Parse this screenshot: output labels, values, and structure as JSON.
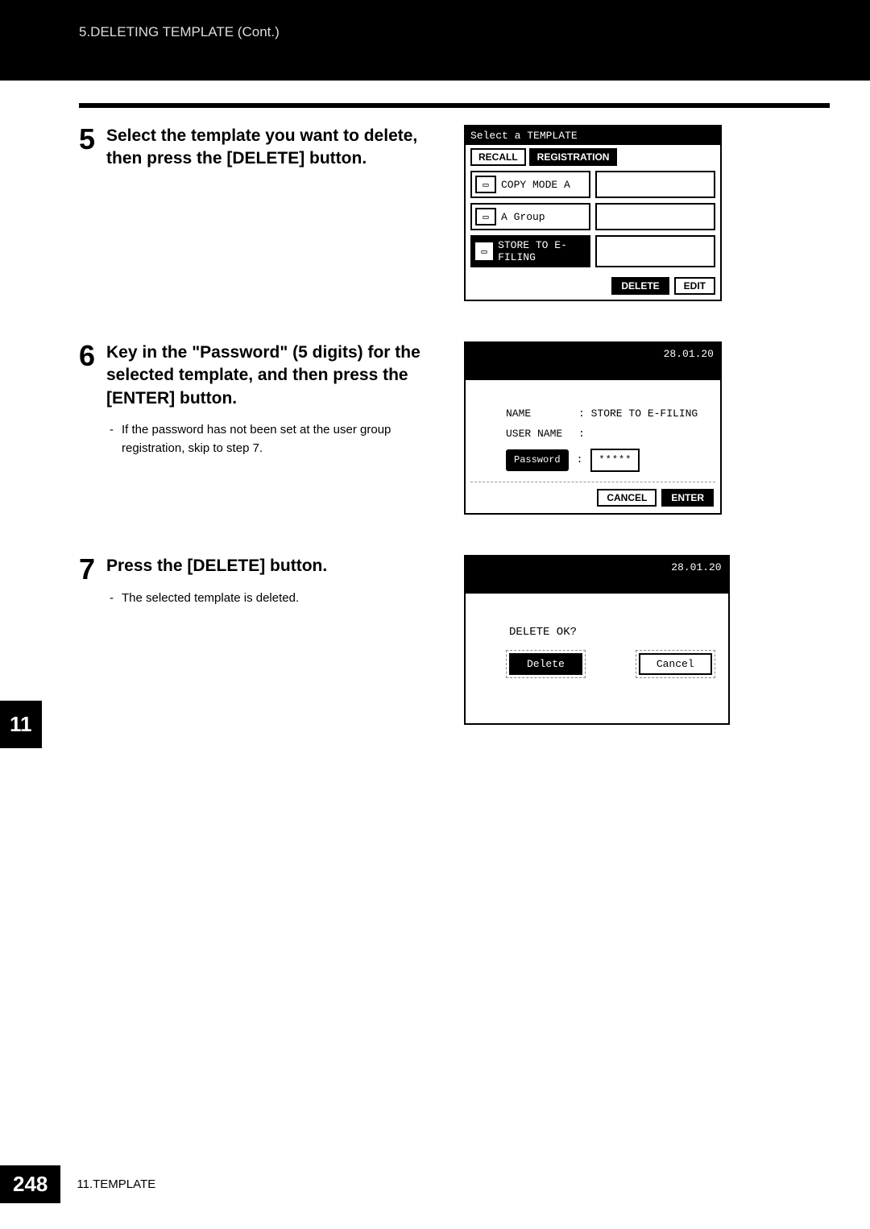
{
  "header": {
    "breadcrumb": "5.DELETING TEMPLATE (Cont.)"
  },
  "sideTab": "11",
  "footer": {
    "pageNum": "248",
    "chapter": "11.TEMPLATE"
  },
  "steps": [
    {
      "num": "5",
      "heading": "Select the template you want to delete, then press the [DELETE] button."
    },
    {
      "num": "6",
      "heading": "Key in the \"Password\" (5 digits) for the selected template, and then press the [ENTER] button.",
      "bullet": "If the password has not been set at the user group registration, skip to step 7."
    },
    {
      "num": "7",
      "heading": "Press the [DELETE] button.",
      "bullet": "The selected template is deleted."
    }
  ],
  "screen1": {
    "title": "Select a TEMPLATE",
    "tabs": {
      "recall": "RECALL",
      "registration": "REGISTRATION"
    },
    "rows": [
      {
        "label": "COPY MODE A",
        "selected": false
      },
      {
        "label": "A Group",
        "selected": false
      },
      {
        "label": "STORE TO E-FILING",
        "selected": true
      }
    ],
    "buttons": {
      "delete": "DELETE",
      "edit": "EDIT"
    }
  },
  "screen2": {
    "date": "28.01.20",
    "nameLabel": "NAME",
    "nameValue": ": STORE TO E-FILING",
    "userLabel": "USER NAME",
    "userValue": ":",
    "pwLabel": "Password",
    "pwColon": ":",
    "pwValue": "*****",
    "cancel": "CANCEL",
    "enter": "ENTER"
  },
  "screen3": {
    "date": "28.01.20",
    "prompt": "DELETE OK?",
    "delete": "Delete",
    "cancel": "Cancel"
  }
}
